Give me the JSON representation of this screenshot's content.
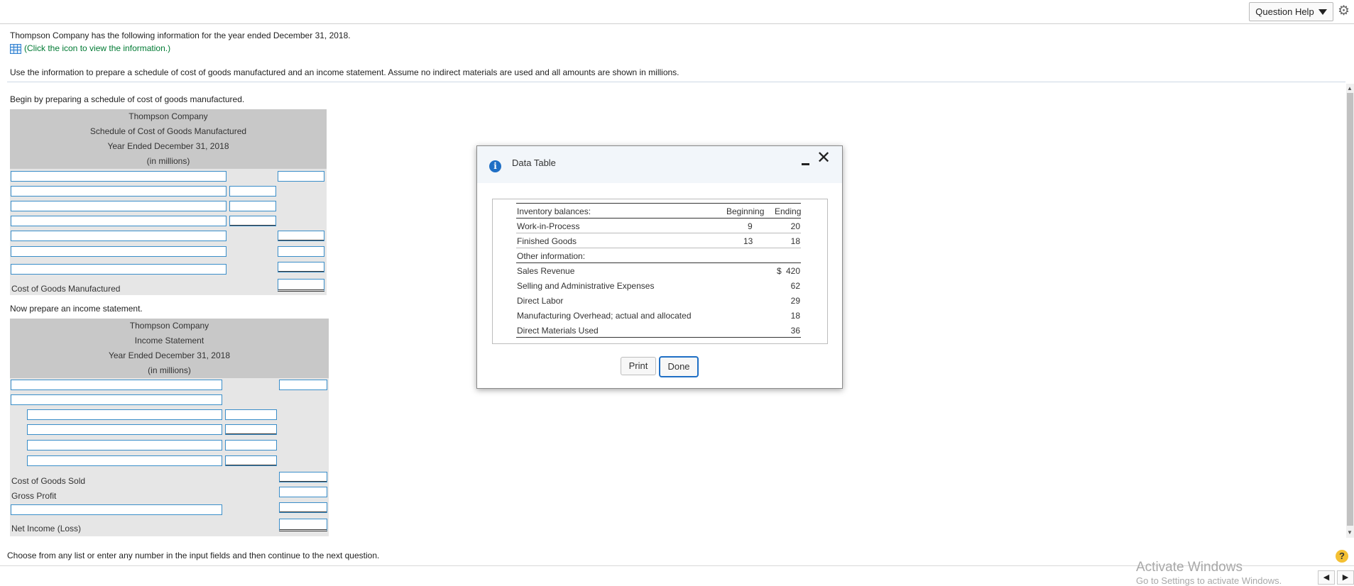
{
  "header": {
    "question_help": "Question Help"
  },
  "problem": {
    "intro": "Thompson Company has the following information for the year ended December 31, 2018.",
    "click_icon": "(Click the icon to view the information.)",
    "instructions": "Use the information to prepare a schedule of cost of goods manufactured and an income statement. Assume no indirect materials are used and all amounts are shown in millions."
  },
  "cogm": {
    "lead": "Begin by preparing a schedule of cost of goods manufactured.",
    "company": "Thompson Company",
    "title": "Schedule of Cost of Goods Manufactured",
    "period": "Year Ended December 31, 2018",
    "units": "(in millions)",
    "total_label": "Cost of Goods Manufactured"
  },
  "income": {
    "lead": "Now prepare an income statement.",
    "company": "Thompson Company",
    "title": "Income Statement",
    "period": "Year Ended December 31, 2018",
    "units": "(in millions)",
    "cogs_label": "Cost of Goods Sold",
    "gross_label": "Gross Profit",
    "net_label": "Net Income (Loss)"
  },
  "footer": {
    "instruction": "Choose from any list or enter any number in the input fields and then continue to the next question.",
    "watermark_title": "Activate Windows",
    "watermark_sub": "Go to Settings to activate Windows."
  },
  "dialog": {
    "title": "Data Table",
    "header_label": "Inventory balances:",
    "col_beginning": "Beginning",
    "col_ending": "Ending",
    "rows": [
      {
        "label": "Work-in-Process",
        "beginning": "9",
        "ending": "20"
      },
      {
        "label": "Finished Goods",
        "beginning": "13",
        "ending": "18"
      }
    ],
    "other_label": "Other information:",
    "other_rows": [
      {
        "label": "Sales Revenue",
        "currency": "$",
        "value": "420"
      },
      {
        "label": "Selling and Administrative Expenses",
        "value": "62"
      },
      {
        "label": "Direct Labor",
        "value": "29"
      },
      {
        "label": "Manufacturing Overhead; actual and allocated",
        "value": "18"
      },
      {
        "label": "Direct Materials Used",
        "value": "36"
      }
    ],
    "print_label": "Print",
    "done_label": "Done"
  },
  "colors": {
    "input_border": "#3a8ec9",
    "panel_bg": "#e6e6e6",
    "panel_header_bg": "#c8c8c8",
    "accent": "#1f6fc5"
  }
}
